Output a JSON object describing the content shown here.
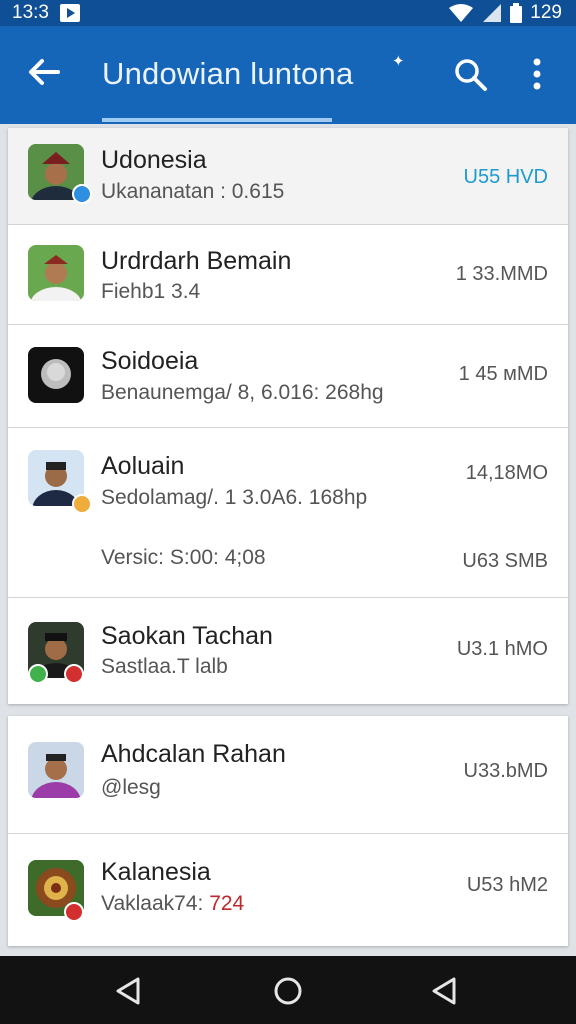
{
  "status_bar": {
    "time": "13:3",
    "battery": "129"
  },
  "app_bar": {
    "title": "Undowian luntona"
  },
  "list": [
    {
      "name": "Udonesia",
      "subtitle": "Ukananatan : 0.615",
      "size": "U55 HVD"
    },
    {
      "name": "Urdrdarh Bemain",
      "subtitle": "Fiehb1 3.4",
      "size": "1 33.MMD"
    },
    {
      "name": "Soidoeia",
      "subtitle": "Benaunemga/ 8, 6.016: 268hg",
      "size": "1 45 мMD"
    },
    {
      "name": "Aoluain",
      "subtitle": "Sedolamag/. 1 3.0A6. 168hp",
      "size": "14,18MO",
      "extra": "Versic: S:00: 4;08",
      "extra_size": "U63 SMB"
    },
    {
      "name": "Saokan Tachan",
      "subtitle": "Sastlaa.T lalb",
      "size": "U3.1 hMO"
    }
  ],
  "list2": [
    {
      "name": "Ahdcalan Rahan",
      "subtitle": "@lesg",
      "size": "U33.bMD"
    },
    {
      "name": "Kalanesia",
      "subtitle_prefix": "Vaklaak74:",
      "subtitle_value": "724",
      "size": "U53 hM2"
    }
  ],
  "colors": {
    "app_bar": "#1565b8",
    "status_bar": "#0f4f96",
    "accent_size": "#1d9bd1",
    "red_value": "#c0282e"
  },
  "icons": {
    "back": "arrow-left-icon",
    "search": "search-icon",
    "more": "more-vert-icon",
    "nav_back": "triangle-back-icon",
    "nav_home": "circle-home-icon",
    "nav_recent": "triangle-recent-icon"
  }
}
